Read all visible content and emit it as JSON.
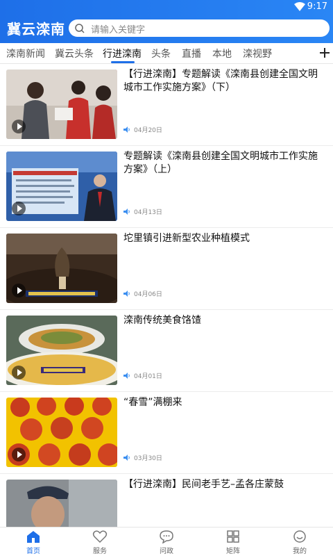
{
  "status": {
    "time": "9:17"
  },
  "header": {
    "brand": "冀云滦南",
    "search_placeholder": "请输入关键字"
  },
  "tabs": [
    {
      "label": "滦南新闻",
      "active": false
    },
    {
      "label": "冀云头条",
      "active": false
    },
    {
      "label": "行进滦南",
      "active": true
    },
    {
      "label": "头条",
      "active": false
    },
    {
      "label": "直播",
      "active": false
    },
    {
      "label": "本地",
      "active": false
    },
    {
      "label": "滦视野",
      "active": false
    }
  ],
  "news": [
    {
      "title": "【行进滦南】专题解读《滦南县创建全国文明城市工作实施方案》（下）",
      "date": "04月20日",
      "thumb": "people-in-red-vests"
    },
    {
      "title": "专题解读《滦南县创建全国文明城市工作实施方案》（上）",
      "date": "04月13日",
      "thumb": "news-anchor"
    },
    {
      "title": "坨里镇引进新型农业种植模式",
      "date": "04月06日",
      "thumb": "morel-mushrooms"
    },
    {
      "title": "滦南传统美食饹馇",
      "date": "04月01日",
      "thumb": "food-plate"
    },
    {
      "title": "“春雪”满棚来",
      "date": "03月30日",
      "thumb": "peaches"
    },
    {
      "title": "【行进滦南】民间老手艺–孟各庄蒙鼓",
      "date": "",
      "thumb": "old-man"
    }
  ],
  "bottom_nav": [
    {
      "label": "首页",
      "icon": "home-icon",
      "active": true
    },
    {
      "label": "服务",
      "icon": "heart-icon",
      "active": false
    },
    {
      "label": "问政",
      "icon": "chat-icon",
      "active": false
    },
    {
      "label": "矩阵",
      "icon": "grid-icon",
      "active": false
    },
    {
      "label": "我的",
      "icon": "user-icon",
      "active": false
    }
  ],
  "colors": {
    "accent": "#1e6fe8",
    "header": "#2a86f5"
  }
}
